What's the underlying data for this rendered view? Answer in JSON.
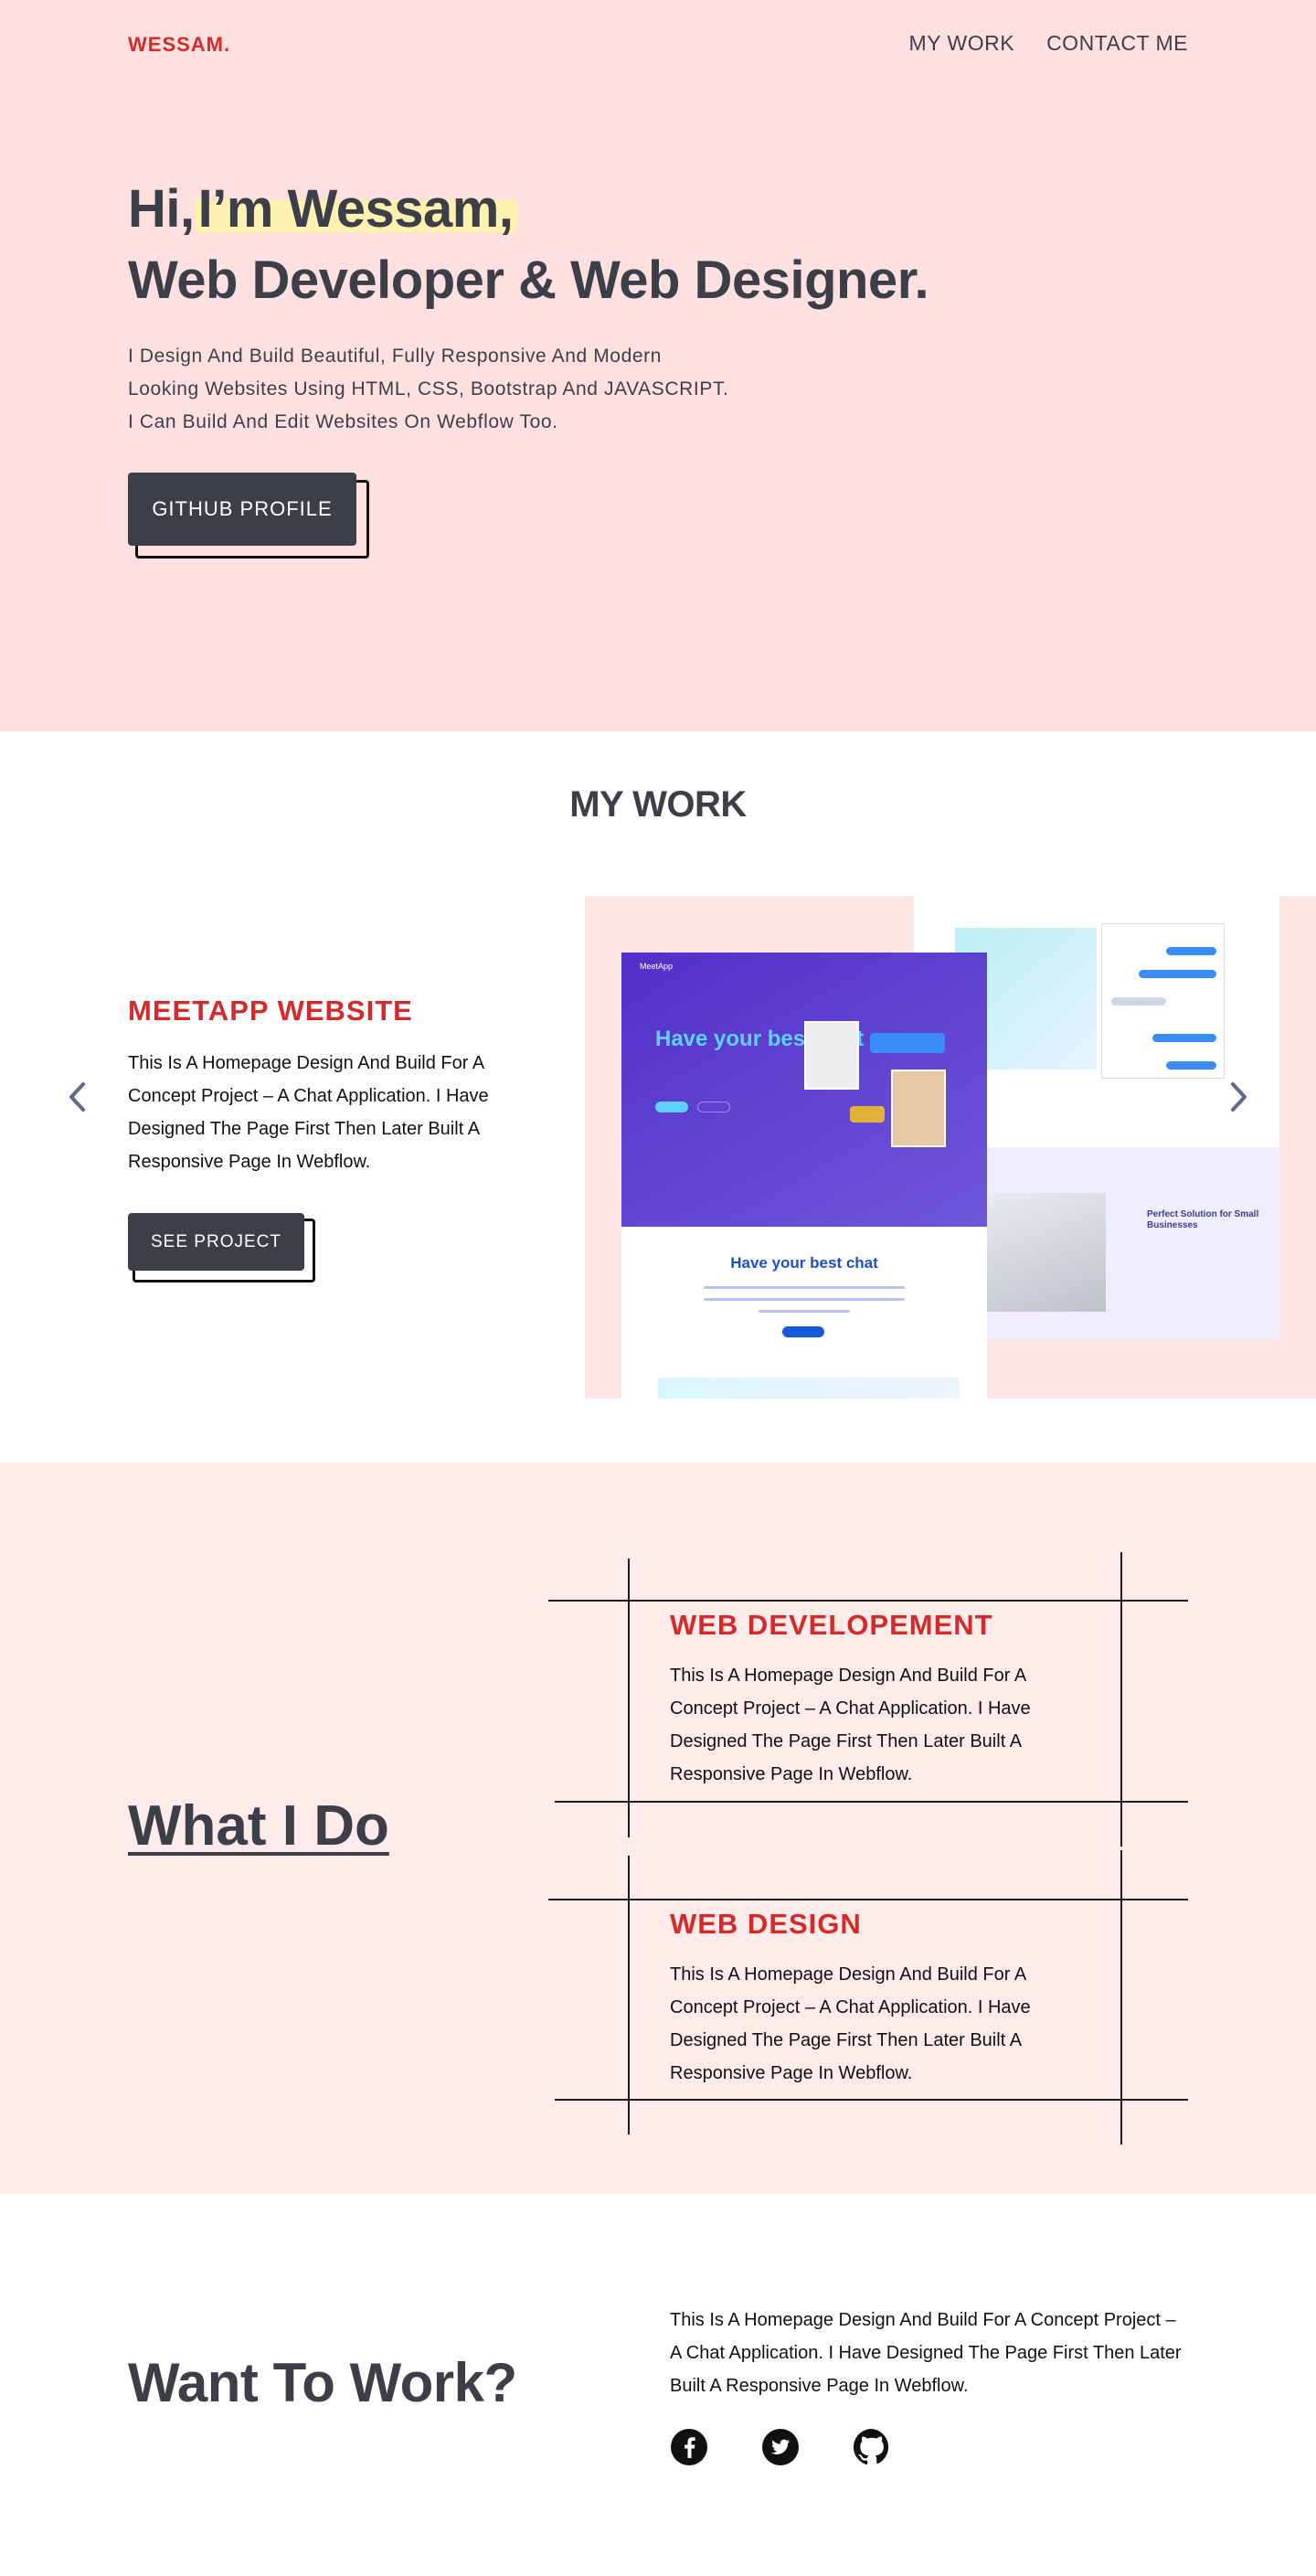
{
  "header": {
    "logo": "WESSAM.",
    "nav": [
      "MY WORK",
      "CONTACT ME"
    ]
  },
  "hero": {
    "greeting": "Hi,",
    "name": "I’m Wessam,",
    "role": "Web Developer & Web Designer.",
    "description": [
      "I Design And Build Beautiful, Fully Responsive And Modern",
      "Looking Websites Using HTML, CSS, Bootstrap And JAVASCRIPT.",
      "I Can Build And Edit Websites On Webflow Too."
    ],
    "button": "GITHUB PROFILE"
  },
  "work": {
    "title": "MY WORK",
    "project": {
      "title": "MEETAPP WEBSITE",
      "description": "This Is A Homepage Design And Build For A Concept Project – A Chat Application. I Have Designed The Page First Then Later Built A Responsive Page In Webflow.",
      "button": "SEE PROJECT"
    },
    "mockup": {
      "brand": "MeetApp",
      "headline": "Have your best chat",
      "subheadline": "Have your best chat",
      "side_title": "Perfect Solution for Small Businesses"
    }
  },
  "services": {
    "title": "What I Do",
    "items": [
      {
        "title": "WEB DEVELOPEMENT",
        "description": "This Is A Homepage Design And Build For A Concept Project – A Chat Application. I Have Designed The Page First Then Later Built A Responsive Page In Webflow."
      },
      {
        "title": "WEB DESIGN",
        "description": "This Is A Homepage Design And Build For A Concept Project – A Chat Application. I Have Designed The Page First Then Later Built A Responsive Page In Webflow."
      }
    ]
  },
  "contact": {
    "title": "Want To Work?",
    "description": "This Is A Homepage Design And Build For A Concept Project – A Chat Application. I Have Designed The Page First Then Later Built A Responsive Page In Webflow.",
    "socials": [
      "facebook-icon",
      "twitter-icon",
      "github-icon"
    ]
  },
  "colors": {
    "accent": "#d42a2a",
    "dark": "#3d3f48",
    "hero_bg": "#ffe0e0",
    "services_bg": "#ffebea",
    "highlight": "#fff1b0"
  }
}
